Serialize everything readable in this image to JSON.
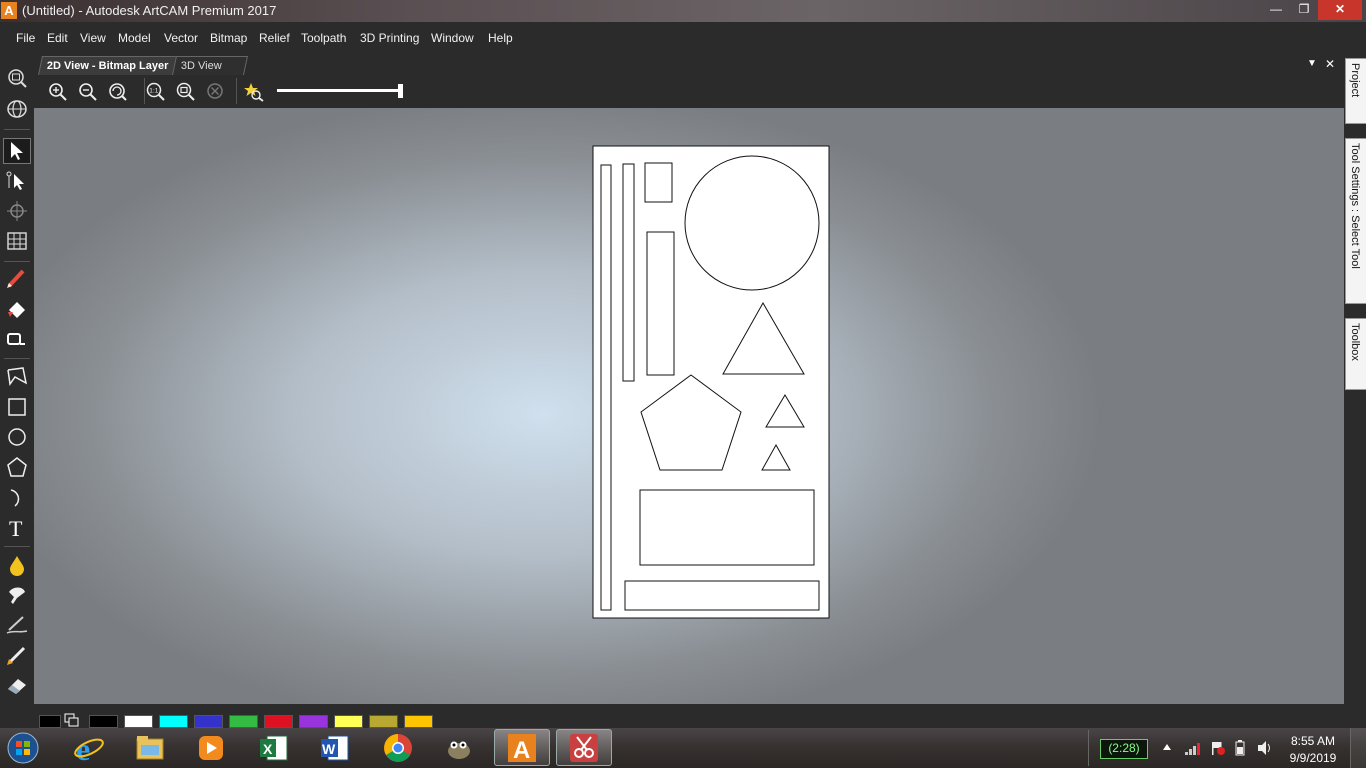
{
  "window": {
    "logo_letter": "A",
    "title": "(Untitled) - Autodesk ArtCAM Premium 2017",
    "minimize": "—",
    "restore": "❐",
    "close": "✕"
  },
  "menu": {
    "items": [
      "File",
      "Edit",
      "View",
      "Model",
      "Vector",
      "Bitmap",
      "Relief",
      "Toolpath",
      "3D Printing",
      "Window",
      "Help"
    ]
  },
  "view_tabs": {
    "tabs": [
      "2D View - Bitmap Layer",
      "3D View"
    ],
    "active": "2D View - Bitmap Layer",
    "dropdown_glyph": "▼",
    "close_glyph": "✕"
  },
  "view_toolbar": {
    "icons": [
      "zoom-in-icon",
      "zoom-out-icon",
      "zoom-previous-icon",
      "zoom-1-to-1-icon",
      "zoom-to-fit-icon",
      "zoom-disabled-icon",
      "favorite-zoom-icon"
    ],
    "zoom_slider_level": 1.0
  },
  "left_toolbar": {
    "icons": [
      "zoom-view-icon",
      "orbit-icon",
      "select-arrow-icon",
      "node-edit-icon",
      "transform-icon",
      "grid-icon",
      "pencil-icon",
      "fill-bucket-icon",
      "magnifier-icon",
      "polyline-icon",
      "rectangle-icon",
      "circle-icon",
      "polygon-icon",
      "arc-icon",
      "text-icon",
      "drop-icon",
      "smooth-icon",
      "sculpt-icon",
      "brush-icon",
      "eraser-icon",
      "paint-icon"
    ]
  },
  "right_panel": {
    "tabs": [
      "Project",
      "Tool Settings : Select Tool",
      "Toolbox"
    ]
  },
  "palette": {
    "primary": "#000000",
    "colors": [
      "#000000",
      "#ffffff",
      "#00ffff",
      "#3333cc",
      "#33bb44",
      "#dd1122",
      "#9933dd",
      "#ffff55",
      "#b8a832",
      "#ffc400"
    ]
  },
  "taskbar": {
    "apps": [
      "start-orb-icon",
      "internet-explorer-icon",
      "file-explorer-icon",
      "media-player-icon",
      "excel-icon",
      "word-icon",
      "chrome-icon",
      "gimp-icon",
      "artcam-icon",
      "snipping-tool-icon"
    ],
    "battery": "(2:28)",
    "time": "8:55 AM",
    "date": "9/9/2019"
  }
}
